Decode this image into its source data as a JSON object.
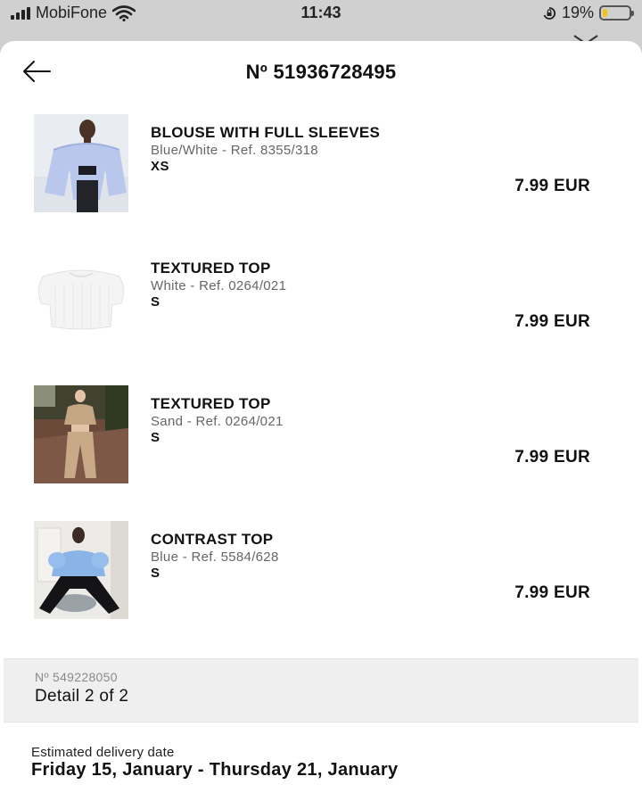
{
  "status_bar": {
    "carrier": "MobiFone",
    "time": "11:43",
    "battery_percent": "19%",
    "battery_level": 0.19,
    "icons": [
      "signal-icon",
      "wifi-icon",
      "orientation-lock-icon",
      "battery-icon"
    ]
  },
  "header": {
    "back_icon": "arrow-left-icon",
    "order_number": "Nº 51936728495"
  },
  "items": [
    {
      "name": "BLOUSE WITH FULL SLEEVES",
      "ref": "Blue/White - Ref. 8355/318",
      "size": "XS",
      "price": "7.99 EUR"
    },
    {
      "name": "TEXTURED TOP",
      "ref": "White - Ref. 0264/021",
      "size": "S",
      "price": "7.99 EUR"
    },
    {
      "name": "TEXTURED TOP",
      "ref": "Sand - Ref. 0264/021",
      "size": "S",
      "price": "7.99 EUR"
    },
    {
      "name": "CONTRAST TOP",
      "ref": "Blue - Ref. 5584/628",
      "size": "S",
      "price": "7.99 EUR"
    }
  ],
  "detail": {
    "number": "Nº 549228050",
    "count_label": "Detail 2 of 2"
  },
  "delivery": {
    "label": "Estimated delivery date",
    "range": "Friday 15, January - Thursday 21, January"
  }
}
